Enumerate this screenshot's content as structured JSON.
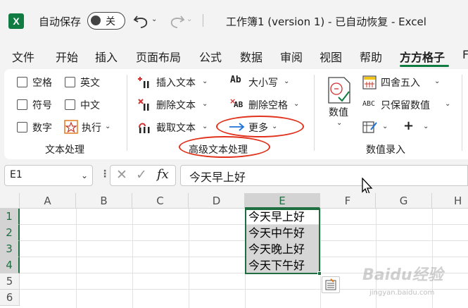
{
  "titlebar": {
    "app_icon_letter": "X",
    "autosave_label": "自动保存",
    "autosave_state": "关",
    "document_title": "工作簿1 (version 1)  -  已自动恢复  -  Excel"
  },
  "ribbon_tabs": [
    "文件",
    "开始",
    "插入",
    "页面布局",
    "公式",
    "数据",
    "审阅",
    "视图",
    "帮助",
    "方方格子",
    "F"
  ],
  "active_tab": "方方格子",
  "text_group": {
    "checkboxes": [
      "空格",
      "英文",
      "符号",
      "中文",
      "数字"
    ],
    "execute_label": "执行",
    "label": "文本处理"
  },
  "advanced_text_group": {
    "insert_text": "插入文本",
    "delete_text": "删除文本",
    "extract_text": "截取文本",
    "case_label": "大小写",
    "case_icon_text": "Ab",
    "delete_spaces": "删除空格",
    "delete_spaces_icon_text": "AB",
    "more": "更多",
    "label": "高级文本处理"
  },
  "numeric_group": {
    "numeric_label": "数值",
    "round": "四舍五入",
    "keep_numeric": "只保留数值",
    "keep_numeric_icon_text": "ABC",
    "plus": "+",
    "label": "数值录入"
  },
  "formula_bar": {
    "name_box": "E1",
    "fx_label": "fx",
    "formula": "今天早上好"
  },
  "grid": {
    "columns": [
      "A",
      "B",
      "C",
      "D",
      "E",
      "F",
      "G",
      "H"
    ],
    "rows": [
      "1",
      "2",
      "3",
      "4",
      "5",
      "6"
    ],
    "selected_column": "E",
    "cells_E": [
      "今天早上好",
      "今天中午好",
      "今天晚上好",
      "今天下午好"
    ]
  },
  "watermark": {
    "line1": "Baidu经验",
    "line2": "jingyan.baidu.com"
  },
  "colors": {
    "excel_green": "#107c41",
    "selection_green": "#1e6e42",
    "annotation_red": "#e0321c"
  }
}
